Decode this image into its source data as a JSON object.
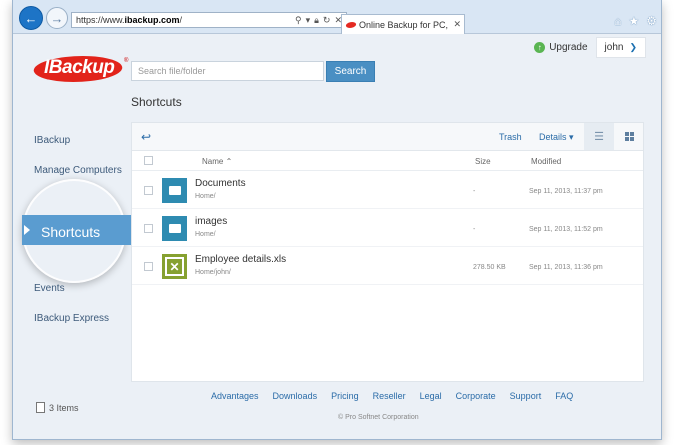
{
  "browser": {
    "url_prefix": "https://www.",
    "url_domain": "ibackup.com",
    "url_suffix": "/",
    "tab_title": "Online Backup for PC, Mac ..."
  },
  "header": {
    "upgrade_label": "Upgrade",
    "user_name": "john",
    "logo_text": "IBackup",
    "logo_reg": "®"
  },
  "search": {
    "placeholder": "Search file/folder",
    "button_label": "Search"
  },
  "page_title": "Shortcuts",
  "sidebar": {
    "items": [
      {
        "label": "IBackup"
      },
      {
        "label": "Manage Computers"
      },
      {
        "label": "Shortcuts"
      },
      {
        "label": "Events"
      },
      {
        "label": "IBackup Express"
      }
    ],
    "items_count": "3 Items"
  },
  "toolbar": {
    "trash_label": "Trash",
    "details_label": "Details ▾"
  },
  "table": {
    "headers": {
      "name": "Name ⌃",
      "size": "Size",
      "modified": "Modified"
    },
    "rows": [
      {
        "name": "Documents",
        "path": "Home/",
        "size": "-",
        "modified": "Sep 11, 2013, 11:37 pm",
        "type": "folder"
      },
      {
        "name": "images",
        "path": "Home/",
        "size": "-",
        "modified": "Sep 11, 2013, 11:52 pm",
        "type": "folder"
      },
      {
        "name": "Employee details.xls",
        "path": "Home/john/",
        "size": "278.50 KB",
        "modified": "Sep 11, 2013, 11:36 pm",
        "type": "xls"
      }
    ]
  },
  "footer": {
    "links": [
      "Advantages",
      "Downloads",
      "Pricing",
      "Reseller",
      "Legal",
      "Corporate",
      "Support",
      "FAQ"
    ],
    "copyright": "© Pro Softnet Corporation"
  },
  "colors": {
    "accent": "#4a8fc3",
    "active_nav": "#5a9cd0",
    "brand_red": "#e2231a",
    "folder": "#2e8bb1",
    "xls": "#86a130"
  }
}
